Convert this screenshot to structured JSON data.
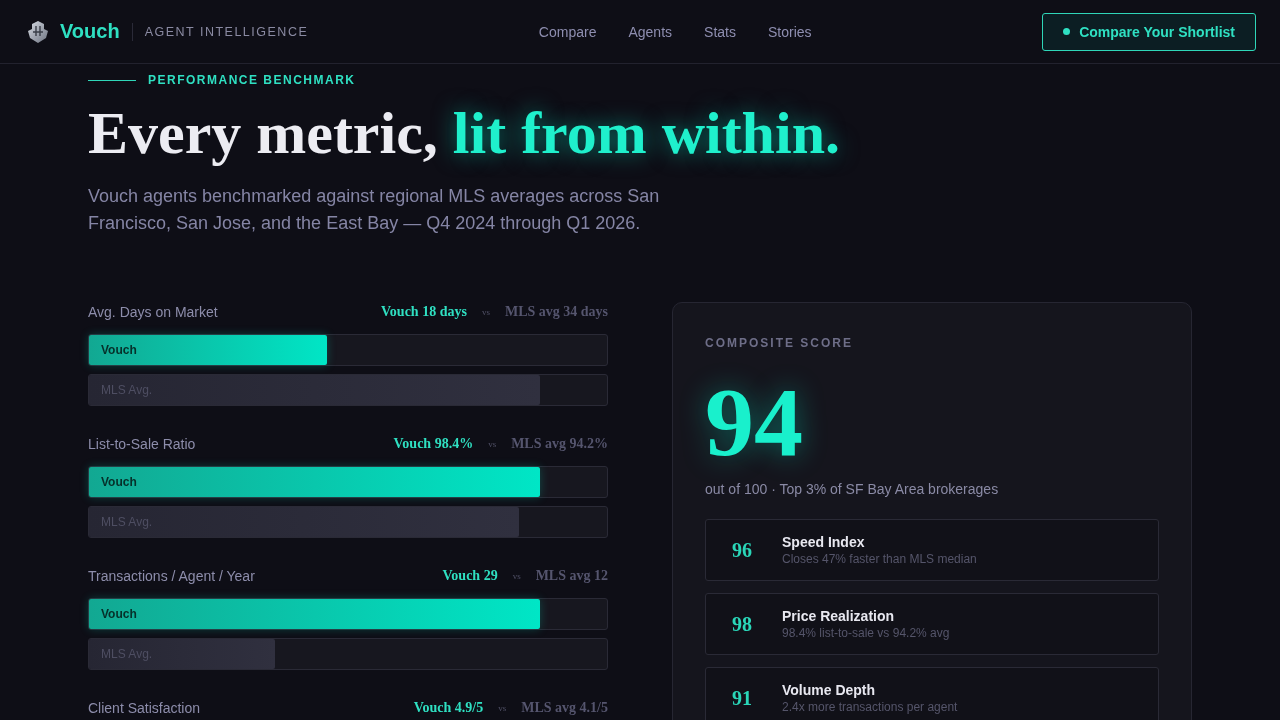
{
  "nav": {
    "brand": "Vouch",
    "tagline": "AGENT INTELLIGENCE",
    "links": [
      "Compare",
      "Agents",
      "Stats",
      "Stories"
    ],
    "cta": "Compare Your Shortlist"
  },
  "hero": {
    "eyebrow": "PERFORMANCE BENCHMARK",
    "headline_lead": "Every metric,",
    "headline_highlight": "lit from within.",
    "subtitle": "Vouch agents benchmarked against regional MLS averages across San Francisco, San Jose, and the East Bay — Q4 2024 through Q1 2026."
  },
  "metrics": [
    {
      "label": "Avg. Days on Market",
      "vouch_value": "Vouch 18 days",
      "vs": "vs",
      "mls_value": "MLS avg 34 days",
      "bars": [
        {
          "kind": "vouch",
          "label": "Vouch",
          "level": 0.46
        },
        {
          "kind": "mls",
          "label": "MLS Avg.",
          "level": 0.87
        }
      ]
    },
    {
      "label": "List-to-Sale Ratio",
      "vouch_value": "Vouch 98.4%",
      "vs": "vs",
      "mls_value": "MLS avg 94.2%",
      "bars": [
        {
          "kind": "vouch",
          "label": "Vouch",
          "level": 0.87
        },
        {
          "kind": "mls",
          "label": "MLS Avg.",
          "level": 0.83
        }
      ]
    },
    {
      "label": "Transactions / Agent / Year",
      "vouch_value": "Vouch 29",
      "vs": "vs",
      "mls_value": "MLS avg 12",
      "bars": [
        {
          "kind": "vouch",
          "label": "Vouch",
          "level": 0.87
        },
        {
          "kind": "mls",
          "label": "MLS Avg.",
          "level": 0.36
        }
      ]
    },
    {
      "label": "Client Satisfaction",
      "vouch_value": "Vouch 4.9/5",
      "vs": "vs",
      "mls_value": "MLS avg 4.1/5"
    }
  ],
  "composite": {
    "eyebrow": "COMPOSITE SCORE",
    "score": "94",
    "caption": "out of 100 · Top 3% of SF Bay Area brokerages",
    "cards": [
      {
        "score": "96",
        "title": "Speed Index",
        "detail": "Closes 47% faster than MLS median"
      },
      {
        "score": "98",
        "title": "Price Realization",
        "detail": "98.4% list-to-sale vs 94.2% avg"
      },
      {
        "score": "91",
        "title": "Volume Depth",
        "detail": "2.4x more transactions per agent"
      }
    ]
  }
}
